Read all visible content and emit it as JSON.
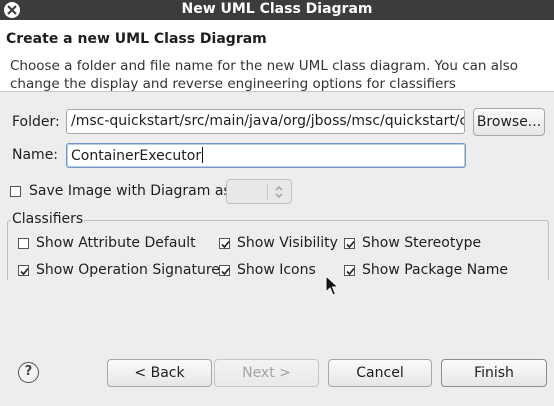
{
  "window": {
    "title": "New UML Class Diagram"
  },
  "banner": {
    "heading": "Create a new UML Class Diagram",
    "description": "Choose a folder and file name for the new UML class diagram. You can also change the display and reverse engineering options for classifiers"
  },
  "form": {
    "folder_label": "Folder:",
    "folder_value": "/msc-quickstart/src/main/java/org/jboss/msc/quickstart/con",
    "browse_label": "Browse...",
    "name_label": "Name:",
    "name_value": "ContainerExecutor",
    "save_image_label": "Save Image with Diagram as",
    "save_image_checked": false,
    "save_image_format": ""
  },
  "classifiers": {
    "title": "Classifiers",
    "options": [
      {
        "label": "Show Attribute Default",
        "checked": false
      },
      {
        "label": "Show Visibility",
        "checked": true
      },
      {
        "label": "Show Stereotype",
        "checked": true
      },
      {
        "label": "Show Operation Signature",
        "checked": true
      },
      {
        "label": "Show Icons",
        "checked": true
      },
      {
        "label": "Show Package Name",
        "checked": true
      }
    ]
  },
  "footer": {
    "help_icon": "question-mark",
    "back_label": "< Back",
    "next_label": "Next >",
    "cancel_label": "Cancel",
    "finish_label": "Finish"
  },
  "icons": {
    "close": "close-icon",
    "combo_arrows": "up-down-arrows-icon",
    "pointer": "mouse-pointer-icon"
  }
}
